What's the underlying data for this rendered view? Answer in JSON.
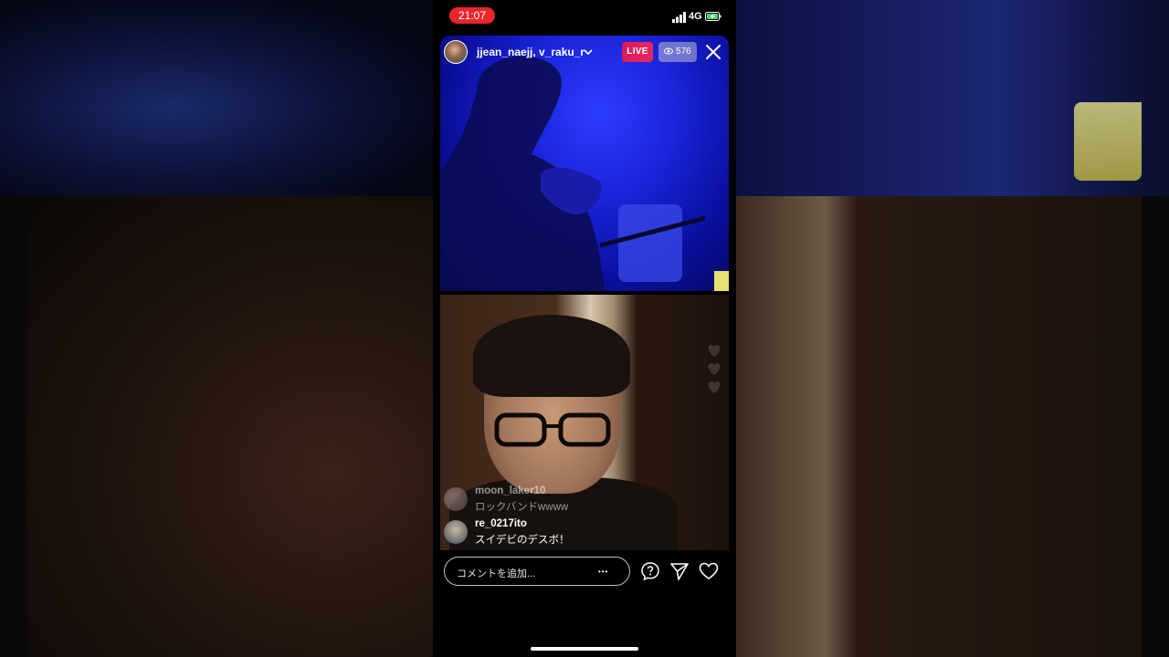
{
  "status_bar": {
    "time": "21:07",
    "network": "4G"
  },
  "live": {
    "host_names": "jjean_naejj, v_raku_r",
    "live_badge": "LIVE",
    "viewer_count": "576"
  },
  "comments": [
    {
      "username": "moon_laker10",
      "text": "ロックバンドwwww",
      "faded": true
    },
    {
      "username": "re_0217ito",
      "text": "スイデビのデスボ！",
      "faded": false
    }
  ],
  "comment_input": {
    "placeholder": "コメントを追加...",
    "more": "•••"
  },
  "colors": {
    "live": "#e8285a",
    "time_pill": "#e8262c"
  }
}
